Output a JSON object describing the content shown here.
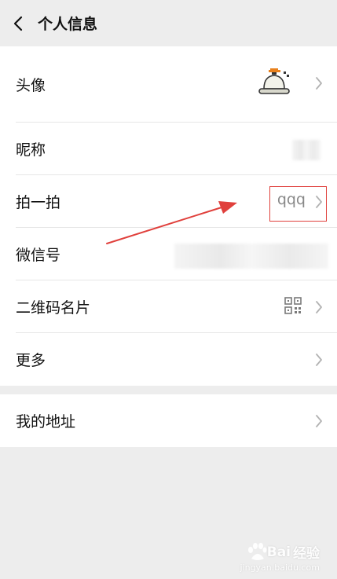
{
  "header": {
    "title": "个人信息",
    "back_icon": "back-chevron-icon"
  },
  "rows": {
    "avatar": {
      "label": "头像"
    },
    "nickname": {
      "label": "昵称"
    },
    "pat": {
      "label": "拍一拍",
      "value": "qqq"
    },
    "wechat_id": {
      "label": "微信号"
    },
    "qr_card": {
      "label": "二维码名片",
      "icon": "qr-code-icon"
    },
    "more": {
      "label": "更多"
    },
    "address": {
      "label": "我的地址"
    }
  },
  "annotation": {
    "highlight_color": "#e0403c"
  },
  "watermark": {
    "text": "Bai",
    "suffix": "经验",
    "sub": "jingyan.baidu.com"
  },
  "colors": {
    "background": "#ededed",
    "card": "#ffffff",
    "text": "#111111",
    "secondary": "#888888"
  }
}
